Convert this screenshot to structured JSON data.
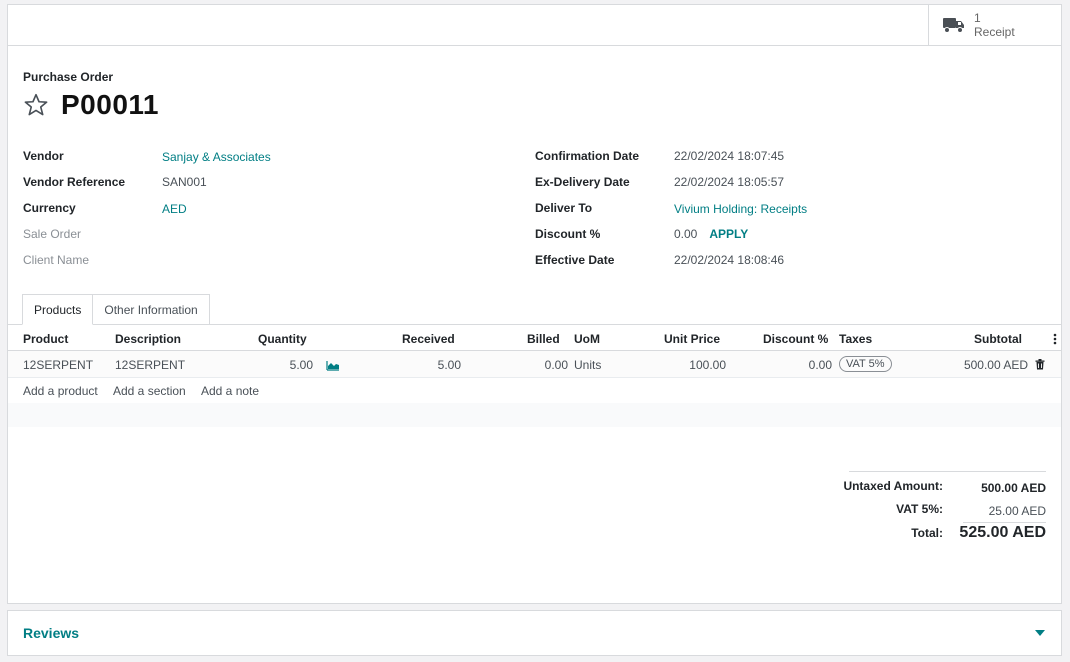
{
  "smart_button": {
    "count": "1",
    "label": "Receipt"
  },
  "title": {
    "label": "Purchase Order",
    "name": "P00011"
  },
  "left_fields": [
    {
      "label": "Vendor",
      "value": "Sanjay & Associates"
    },
    {
      "label": "Vendor Reference",
      "value": "SAN001"
    },
    {
      "label": "Currency",
      "value": "AED"
    },
    {
      "label": "Sale Order",
      "value": ""
    },
    {
      "label": "Client Name",
      "value": ""
    }
  ],
  "right_fields": [
    {
      "label": "Confirmation Date",
      "value": "22/02/2024 18:07:45"
    },
    {
      "label": "Ex-Delivery Date",
      "value": "22/02/2024 18:05:57"
    },
    {
      "label": "Deliver To",
      "value": "Vivium Holding: Receipts"
    },
    {
      "label": "Discount %",
      "value": "0.00",
      "action": "APPLY"
    },
    {
      "label": "Effective Date",
      "value": "22/02/2024 18:08:46"
    }
  ],
  "tabs": [
    "Products",
    "Other Information"
  ],
  "columns": [
    "Product",
    "Description",
    "Quantity",
    "Received",
    "Billed",
    "UoM",
    "Unit Price",
    "Discount %",
    "Taxes",
    "Subtotal"
  ],
  "lines": [
    {
      "product": "12SERPENT",
      "description": "12SERPENT",
      "quantity": "5.00",
      "received": "5.00",
      "billed": "0.00",
      "uom": "Units",
      "unit_price": "100.00",
      "discount": "0.00",
      "taxes": "VAT 5%",
      "subtotal": "500.00 AED"
    }
  ],
  "add_links": [
    "Add a product",
    "Add a section",
    "Add a note"
  ],
  "totals": {
    "untaxed_label": "Untaxed Amount:",
    "untaxed_value": "500.00 AED",
    "vat_label": "VAT 5%:",
    "vat_value": "25.00 AED",
    "total_label": "Total:",
    "total_value": "525.00 AED"
  },
  "reviews": {
    "title": "Reviews"
  },
  "colors": {
    "accent": "#017e84",
    "border": "#d8dadd",
    "background": "#f2f2f4"
  },
  "icons": [
    "truck-icon",
    "star-icon",
    "forecast-chart-icon",
    "trash-icon",
    "column-options-icon",
    "caret-down-icon"
  ]
}
